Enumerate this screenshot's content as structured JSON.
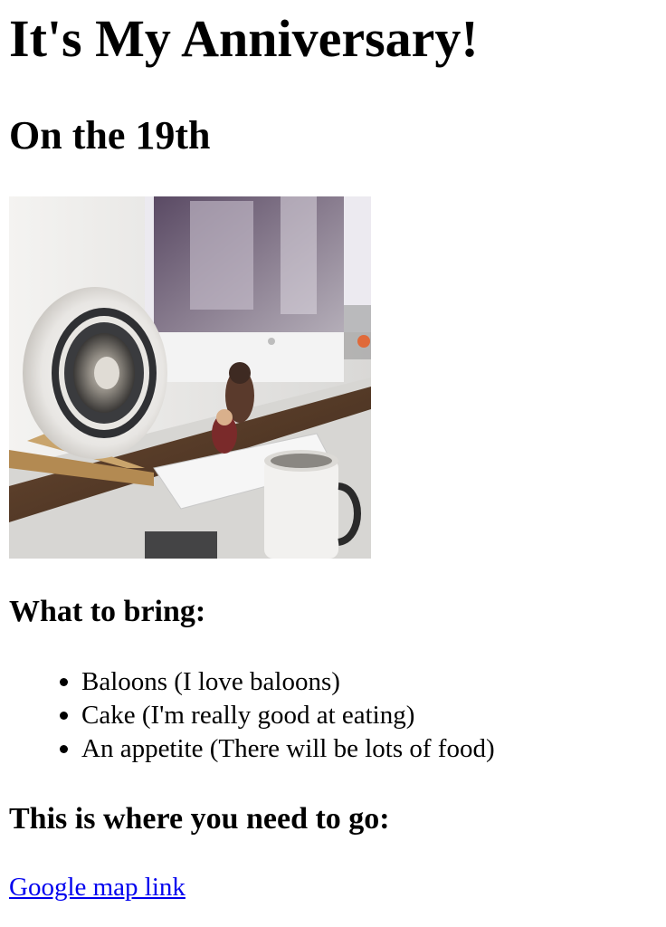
{
  "page": {
    "title": "It's My Anniversary!",
    "subtitle": "On the 19th"
  },
  "photo": {
    "alt": "desk with speaker, monitor, figurine and mug"
  },
  "bring": {
    "heading": "What to bring:",
    "items": [
      {
        "label": "Baloons (I love baloons)"
      },
      {
        "label": "Cake (I'm really good at eating)"
      },
      {
        "label": "An appetite (There will be lots of food)"
      }
    ]
  },
  "location": {
    "heading": "This is where you need to go:",
    "link_label": "Google map link",
    "link_color": "#0000ee"
  }
}
